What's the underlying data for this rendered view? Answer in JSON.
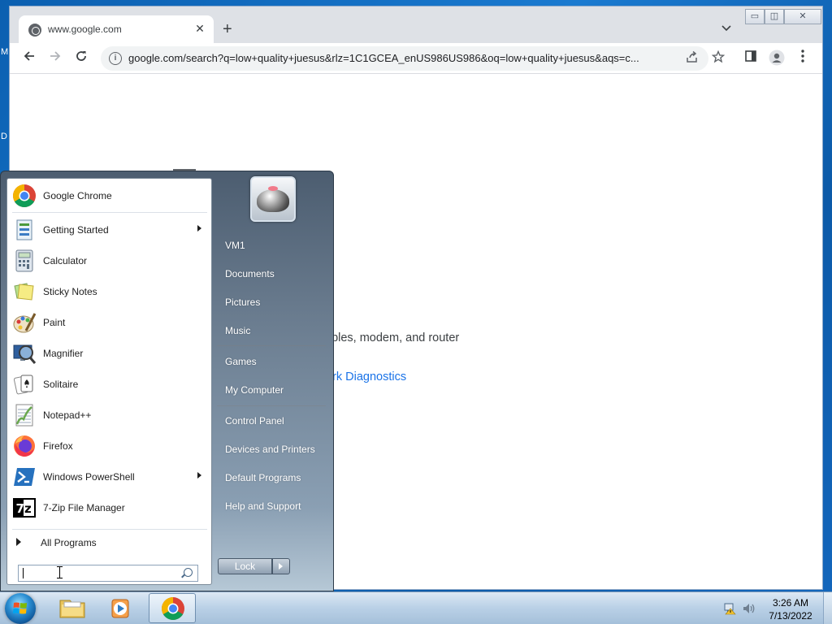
{
  "desktop": {
    "fragments": [
      "M",
      "D"
    ]
  },
  "browser": {
    "tab_title": "www.google.com",
    "url": "google.com/search?q=low+quality+juesus&rlz=1C1GCEA_enUS986US986&oq=low+quality+juesus&aqs=c...",
    "page": {
      "text_fragment": "ables, modem, and router",
      "link_fragment": "ork Diagnostics"
    }
  },
  "start_menu": {
    "programs": [
      {
        "label": "Google Chrome",
        "icon": "chrome-icon",
        "submenu": false
      },
      {
        "label": "Getting Started",
        "icon": "getting-started-icon",
        "submenu": true
      },
      {
        "label": "Calculator",
        "icon": "calculator-icon",
        "submenu": false
      },
      {
        "label": "Sticky Notes",
        "icon": "sticky-notes-icon",
        "submenu": false
      },
      {
        "label": "Paint",
        "icon": "paint-icon",
        "submenu": false
      },
      {
        "label": "Magnifier",
        "icon": "magnifier-icon",
        "submenu": false
      },
      {
        "label": "Solitaire",
        "icon": "solitaire-icon",
        "submenu": false
      },
      {
        "label": "Notepad++",
        "icon": "notepadpp-icon",
        "submenu": false
      },
      {
        "label": "Firefox",
        "icon": "firefox-icon",
        "submenu": false
      },
      {
        "label": "Windows PowerShell",
        "icon": "powershell-icon",
        "submenu": true
      },
      {
        "label": "7-Zip File Manager",
        "icon": "7zip-icon",
        "submenu": false
      }
    ],
    "all_programs": "All Programs",
    "search_value": "",
    "right_links": [
      "VM1",
      "Documents",
      "Pictures",
      "Music",
      "Games",
      "My Computer",
      "Control Panel",
      "Devices and Printers",
      "Default Programs",
      "Help and Support"
    ],
    "lock_label": "Lock"
  },
  "taskbar": {
    "items": [
      "file-explorer-icon",
      "media-player-icon",
      "chrome-icon"
    ],
    "clock": {
      "time": "3:26 AM",
      "date": "7/13/2022"
    }
  },
  "colors": {
    "accent": "#1a73e8",
    "menu_text": "#ffffff"
  }
}
